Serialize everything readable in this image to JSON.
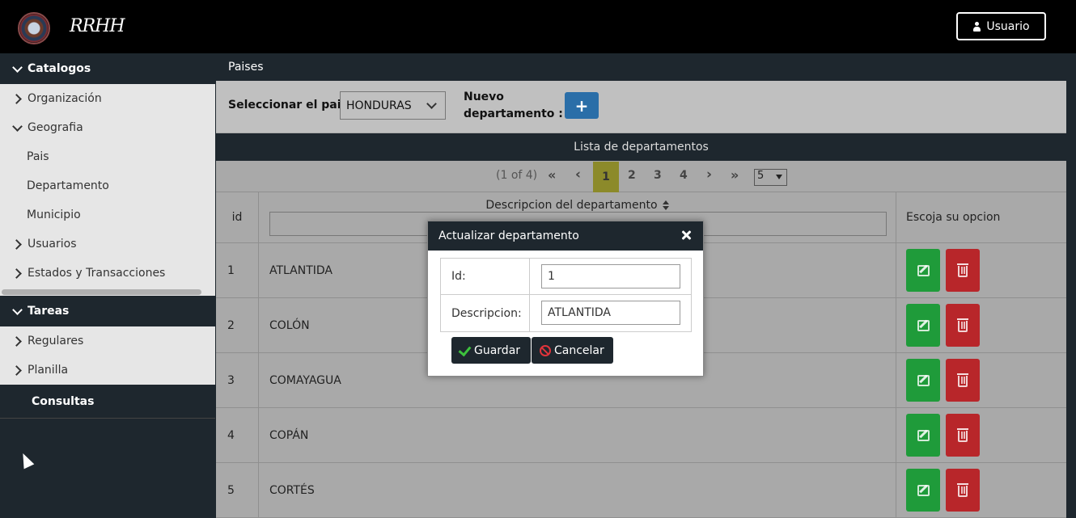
{
  "header": {
    "logo_text": "RRHH",
    "user_button": "Usuario"
  },
  "sidebar": {
    "sections": [
      {
        "title": "Catalogos"
      },
      {
        "title": "Tareas"
      },
      {
        "title": "Consultas"
      }
    ],
    "catalogos_items": [
      "Organización",
      "Geografia",
      "Pais",
      "Departamento",
      "Municipio",
      "Usuarios",
      "Estados y Transacciones"
    ],
    "tareas_items": [
      "Regulares",
      "Planilla"
    ]
  },
  "main": {
    "panel_title": "Paises",
    "select_label": "Seleccionar el pais:",
    "select_value": "HONDURAS",
    "nuevo_line1": "Nuevo",
    "nuevo_line2": "departamento :",
    "add_label": "+",
    "list_title": "Lista de departamentos"
  },
  "pager": {
    "summary": "(1 of 4)",
    "first": "«",
    "prev": "‹",
    "pages": [
      "1",
      "2",
      "3",
      "4"
    ],
    "next": "›",
    "last": "»",
    "rows_per_page": "5"
  },
  "table": {
    "headers": {
      "id": "id",
      "desc": "Descripcion del departamento",
      "options": "Escoja su opcion"
    },
    "rows": [
      {
        "id": "1",
        "desc": "ATLANTIDA"
      },
      {
        "id": "2",
        "desc": "COLÓN"
      },
      {
        "id": "3",
        "desc": "COMAYAGUA"
      },
      {
        "id": "4",
        "desc": "COPÁN"
      },
      {
        "id": "5",
        "desc": "CORTÉS"
      }
    ]
  },
  "dialog": {
    "title": "Actualizar departamento",
    "id_label": "Id:",
    "id_value": "1",
    "desc_label": "Descripcion:",
    "desc_value": "ATLANTIDA",
    "save": "Guardar",
    "cancel": "Cancelar"
  },
  "colors": {
    "accent_blue": "#2a6ea8",
    "edit_green": "#1f9b3a",
    "delete_red": "#b8262a",
    "active_page": "#8c8a2a",
    "dark": "#1e272e"
  }
}
